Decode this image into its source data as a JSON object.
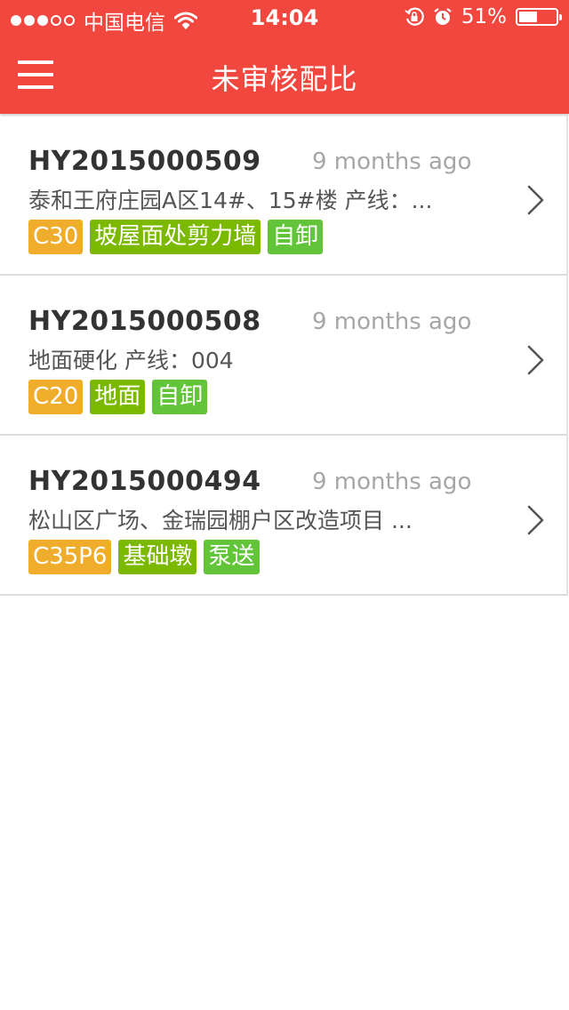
{
  "status_bar": {
    "carrier": "中国电信",
    "time": "14:04",
    "battery_percent": "51%",
    "battery_level": 0.51,
    "icons": [
      "signal-dots-icon",
      "wifi-icon",
      "rotation-lock-icon",
      "alarm-icon",
      "battery-icon"
    ]
  },
  "nav": {
    "title": "未审核配比",
    "menu_icon": "hamburger-menu-icon"
  },
  "colors": {
    "header": "#f1473e",
    "grade_tag": "#f0ad2c",
    "part_tag": "#7bb800",
    "method_tag": "#62c438"
  },
  "items": [
    {
      "code": "HY2015000509",
      "time": "9 months ago",
      "desc": "泰和王府庄园A区14#、15#楼 产线：...",
      "tags": [
        "C30",
        "坡屋面处剪力墙",
        "自卸"
      ]
    },
    {
      "code": "HY2015000508",
      "time": "9 months ago",
      "desc": "地面硬化 产线：004",
      "tags": [
        "C20",
        "地面",
        "自卸"
      ]
    },
    {
      "code": "HY2015000494",
      "time": "9 months ago",
      "desc": "松山区广场、金瑞园棚户区改造项目 ...",
      "tags": [
        "C35P6",
        "基础墩",
        "泵送"
      ]
    }
  ]
}
